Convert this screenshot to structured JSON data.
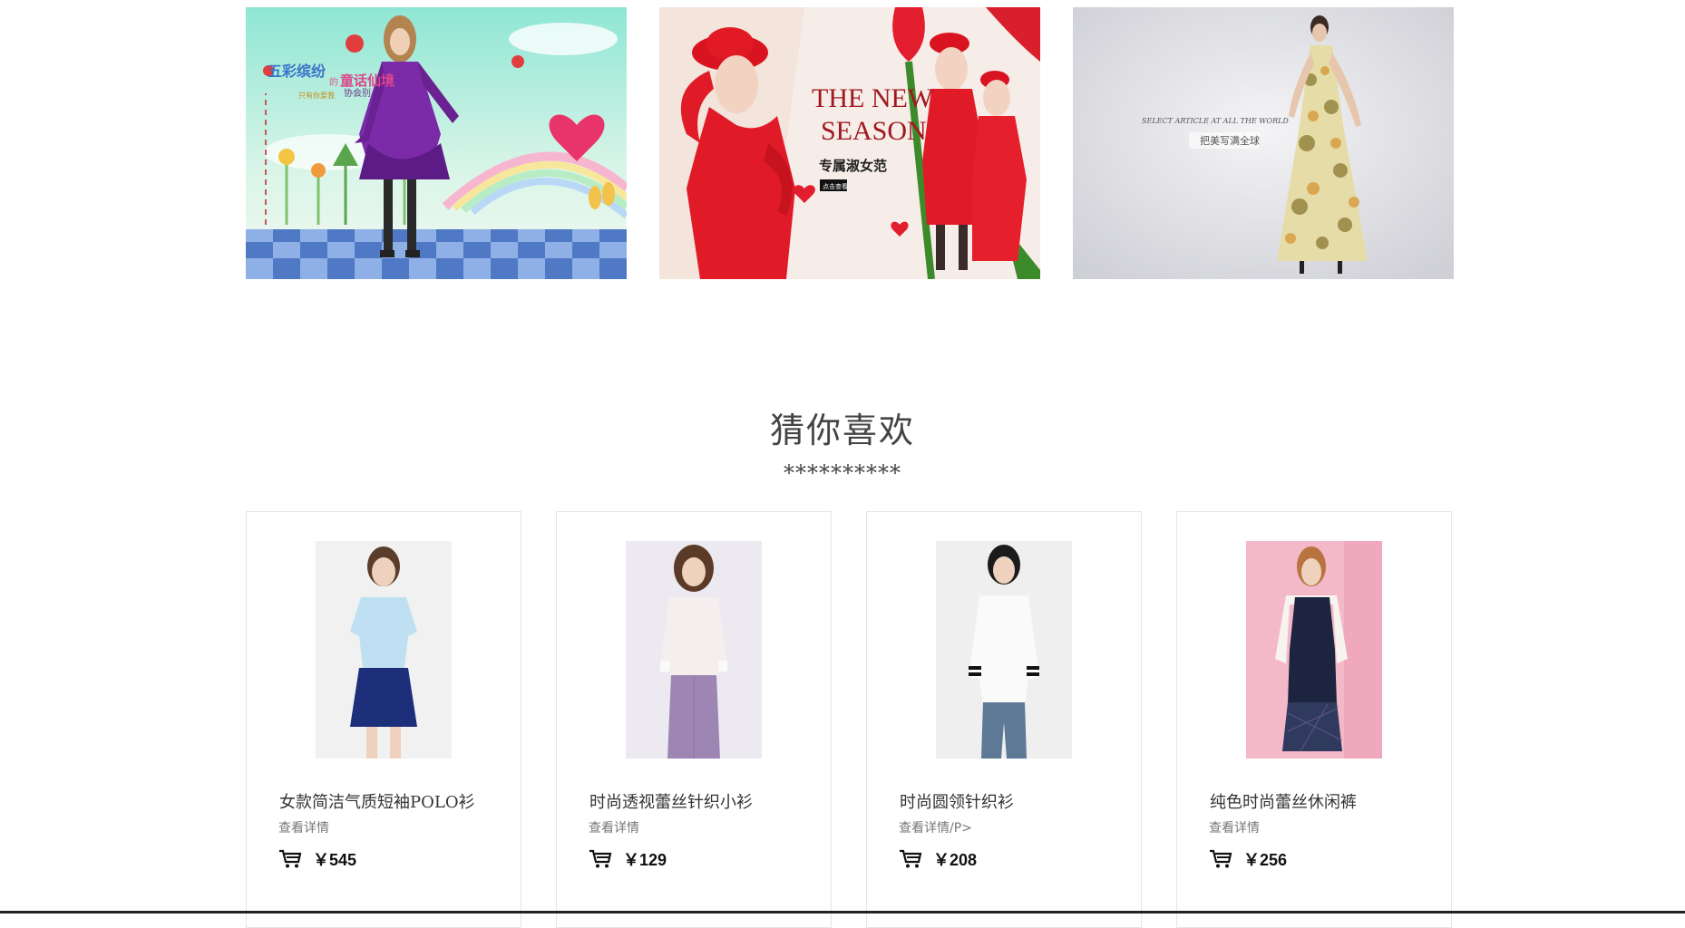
{
  "banners": [
    {
      "name": "banner-fairytale",
      "headline": "五彩缤纷",
      "connector": "的",
      "headline2": "童话仙境",
      "subline": "只有你爱我",
      "subline2": "协会别"
    },
    {
      "name": "banner-new-season",
      "headline": "THE NEW",
      "headline2": "SEASON",
      "subline": "专属淑女范",
      "button": "点击查看"
    },
    {
      "name": "banner-global",
      "headline": "SELECT ARTICLE AT ALL THE WORLD",
      "subline": "把美写满全球"
    }
  ],
  "section": {
    "title": "猜你喜欢",
    "stars": "**********"
  },
  "products": [
    {
      "name": "女款简洁气质短袖POLO衫",
      "detail": "查看详情",
      "price": "￥545",
      "top_color": "#bfe0f2",
      "bottom_color": "#1d2f7a",
      "bg": "#f1f1f1"
    },
    {
      "name": "时尚透视蕾丝针织小衫",
      "detail": "查看详情",
      "price": "￥129",
      "top_color": "#f5eeee",
      "bottom_color": "#9e86b4",
      "bg": "#eceaf0"
    },
    {
      "name": "时尚圆领针织衫",
      "detail": "查看详情/P>",
      "price": "￥208",
      "top_color": "#fafafa",
      "bottom_color": "#5d7996",
      "bg": "#efeff0"
    },
    {
      "name": "纯色时尚蕾丝休闲裤",
      "detail": "查看详情",
      "price": "￥256",
      "top_color": "#1c2440",
      "bottom_color": "#303a5e",
      "bg": "#f3b9c9"
    }
  ],
  "colors": {
    "accent_red": "#e5202b",
    "title_text": "#444444",
    "card_border": "#e6e6e6"
  },
  "icons": {
    "cart": "shopping-cart-icon"
  }
}
